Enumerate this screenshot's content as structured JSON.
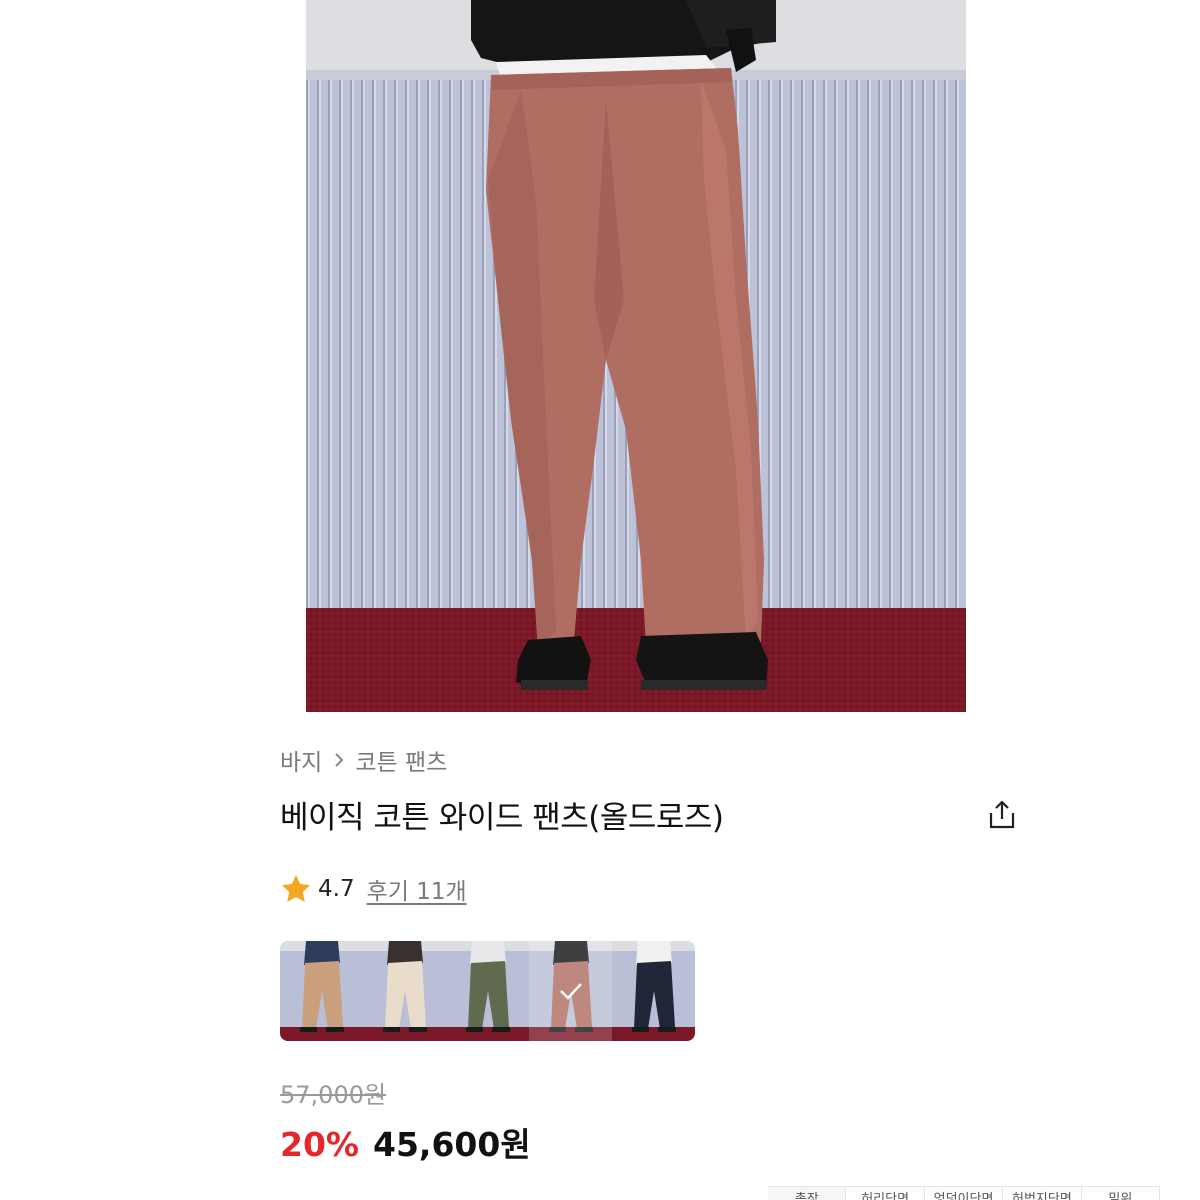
{
  "breadcrumb": {
    "items": [
      "바지",
      "코튼 팬츠"
    ]
  },
  "product": {
    "title": "베이직 코튼 와이드 팬츠(올드로즈)",
    "rating": "4.7",
    "reviews_label": "후기 11개"
  },
  "swatches": [
    {
      "name": "beige",
      "pants_color": "#c99f7d",
      "top_color": "#2f3b5b",
      "selected": false
    },
    {
      "name": "ivory",
      "pants_color": "#e9dccb",
      "top_color": "#3a3030",
      "selected": false
    },
    {
      "name": "khaki",
      "pants_color": "#5f6a4f",
      "top_color": "#e8e8e8",
      "selected": false
    },
    {
      "name": "old-rose",
      "pants_color": "#b06e63",
      "top_color": "#151515",
      "selected": true
    },
    {
      "name": "navy",
      "pants_color": "#1f2638",
      "top_color": "#f1f1f1",
      "selected": false
    }
  ],
  "price": {
    "original": "57,000원",
    "discount": "20%",
    "final": "45,600원"
  },
  "size_table": {
    "headers": [
      "총장",
      "허리단면",
      "엉덩이단면",
      "허벅지단면",
      "밑위"
    ]
  },
  "colors": {
    "discount_red": "#e5262b",
    "star_orange": "#f5a623",
    "pants": "#b06e63",
    "wall": "#b9bfd6",
    "carpet": "#7a1827"
  }
}
